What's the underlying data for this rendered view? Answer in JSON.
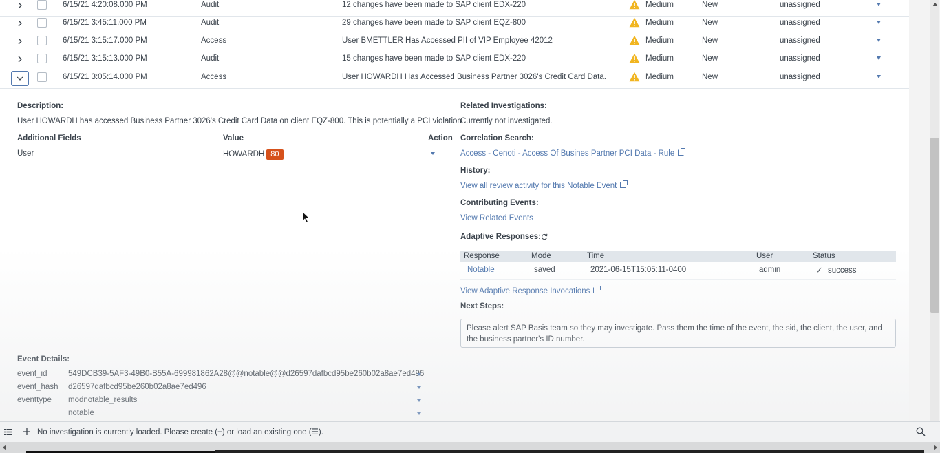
{
  "rows": [
    {
      "time": "6/15/21 4:20:08.000 PM",
      "type": "Audit",
      "title": "12 changes have been made to SAP client EDX-220",
      "urgency": "Medium",
      "status": "New",
      "owner": "unassigned",
      "expanded": false
    },
    {
      "time": "6/15/21 3:45:11.000 PM",
      "type": "Audit",
      "title": "29 changes have been made to SAP client EQZ-800",
      "urgency": "Medium",
      "status": "New",
      "owner": "unassigned",
      "expanded": false
    },
    {
      "time": "6/15/21 3:15:17.000 PM",
      "type": "Access",
      "title": "User BMETTLER Has Accessed PII of VIP Employee 42012",
      "urgency": "Medium",
      "status": "New",
      "owner": "unassigned",
      "expanded": false
    },
    {
      "time": "6/15/21 3:15:13.000 PM",
      "type": "Audit",
      "title": "15 changes have been made to SAP client EDX-220",
      "urgency": "Medium",
      "status": "New",
      "owner": "unassigned",
      "expanded": false
    },
    {
      "time": "6/15/21 3:05:14.000 PM",
      "type": "Access",
      "title": "User HOWARDH Has Accessed Business Partner 3026's Credit Card Data.",
      "urgency": "Medium",
      "status": "New",
      "owner": "unassigned",
      "expanded": true
    }
  ],
  "details": {
    "description_label": "Description:",
    "description_text": "User HOWARDH has accessed Business Partner 3026's Credit Card Data on client EQZ-800. This is potentially a PCI violation.",
    "fields_headers": {
      "field": "Additional Fields",
      "value": "Value",
      "action": "Action"
    },
    "fields": [
      {
        "name": "User",
        "value": "HOWARDH",
        "risk": "80"
      }
    ],
    "related_label": "Related Investigations:",
    "related_text": "Currently not investigated.",
    "correlation_label": "Correlation Search:",
    "correlation_link": "Access - Cenoti - Access Of Busines Partner PCI Data - Rule",
    "history_label": "History:",
    "history_link": "View all review activity for this Notable Event",
    "contributing_label": "Contributing Events:",
    "contributing_link": "View Related Events",
    "adaptive_label": "Adaptive Responses:",
    "responses_headers": {
      "response": "Response",
      "mode": "Mode",
      "time": "Time",
      "user": "User",
      "status": "Status"
    },
    "responses": [
      {
        "response": "Notable",
        "mode": "saved",
        "time": "2021-06-15T15:05:11-0400",
        "user": "admin",
        "status": "success"
      }
    ],
    "invocations_link": "View Adaptive Response Invocations",
    "next_steps_label": "Next Steps:",
    "next_steps_text": "Please alert SAP Basis team so they may investigate. Pass them the time of the event, the sid, the client, the user, and the business partner's ID number.",
    "event_details_label": "Event Details:",
    "event_details": [
      {
        "key": "event_id",
        "value": "549DCB39-5AF3-49B0-B55A-699981862A28@@notable@@d26597dafbcd95be260b02a8ae7ed496"
      },
      {
        "key": "event_hash",
        "value": "d26597dafbcd95be260b02a8ae7ed496"
      },
      {
        "key": "eventtype",
        "value": "modnotable_results"
      },
      {
        "key": "",
        "value": "notable"
      }
    ]
  },
  "bottom_bar": {
    "message": "No investigation is currently loaded. Please create (+) or load an existing one (☰)."
  },
  "colors": {
    "link": "#5379af",
    "risk_badge": "#d6511b",
    "warning": "#f1b520"
  },
  "icons": [
    "chevron-right-icon",
    "chevron-down-icon",
    "warning-icon",
    "external-link-icon",
    "refresh-icon",
    "checkmark-icon",
    "list-icon",
    "plus-icon",
    "zoom-icon"
  ]
}
